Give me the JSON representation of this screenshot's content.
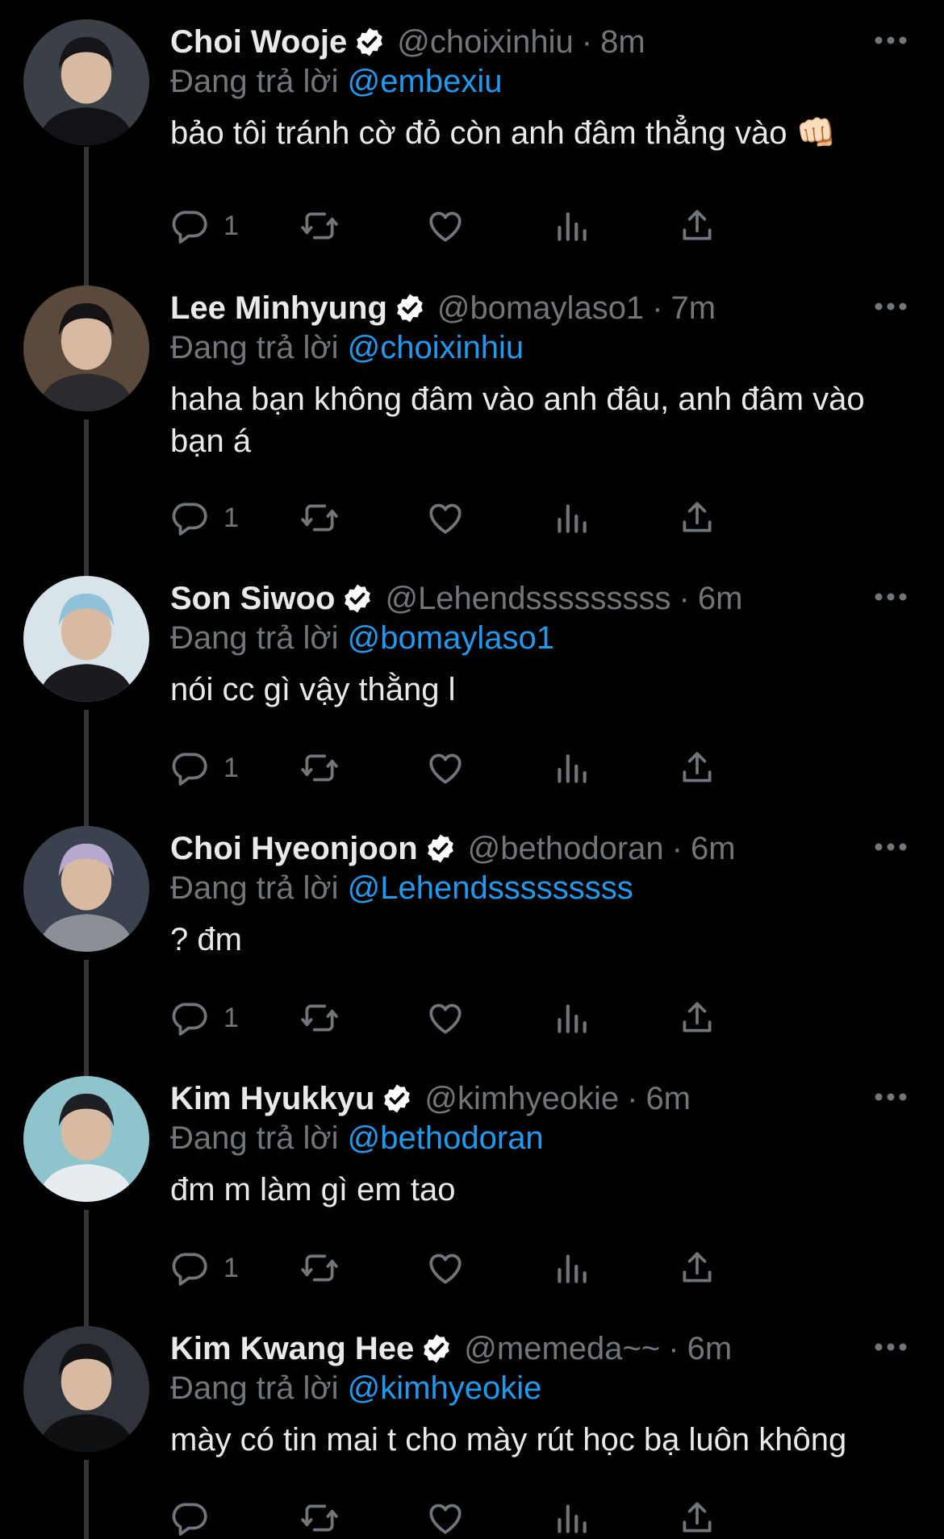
{
  "reply_prefix": "Đang trả lời",
  "colors": {
    "background": "#000000",
    "text": "#e7e9ea",
    "muted": "#71767b",
    "link": "#1d9bf0",
    "thread_line": "#333639"
  },
  "icons": [
    "verified-badge-icon",
    "more-icon",
    "reply-icon",
    "retweet-icon",
    "like-icon",
    "views-icon",
    "share-icon"
  ],
  "tweets": [
    {
      "name": "Choi Wooje",
      "handle": "@choixinhiu",
      "time": "8m",
      "replying_to": "@embexiu",
      "text": "bảo tôi tránh cờ đỏ còn anh đâm thẳng vào 👊🏻",
      "reply_count": "1"
    },
    {
      "name": "Lee Minhyung",
      "handle": "@bomaylaso1",
      "time": "7m",
      "replying_to": "@choixinhiu",
      "text": "haha bạn không đâm vào anh đâu, anh đâm vào bạn á",
      "reply_count": "1"
    },
    {
      "name": "Son Siwoo",
      "handle": "@Lehendsssssssss",
      "time": "6m",
      "replying_to": "@bomaylaso1",
      "text": "nói cc gì vậy thằng l",
      "reply_count": "1"
    },
    {
      "name": "Choi Hyeonjoon",
      "handle": "@bethodoran",
      "time": "6m",
      "replying_to": "@Lehendsssssssss",
      "text": "? đm",
      "reply_count": "1"
    },
    {
      "name": "Kim Hyukkyu",
      "handle": "@kimhyeokie",
      "time": "6m",
      "replying_to": "@bethodoran",
      "text": "đm m làm gì em tao",
      "reply_count": "1"
    },
    {
      "name": "Kim Kwang Hee",
      "handle": "@memeda~~",
      "time": "6m",
      "replying_to": "@kimhyeokie",
      "text": "mày có tin mai t cho mày rút học bạ luôn không",
      "reply_count": ""
    }
  ]
}
